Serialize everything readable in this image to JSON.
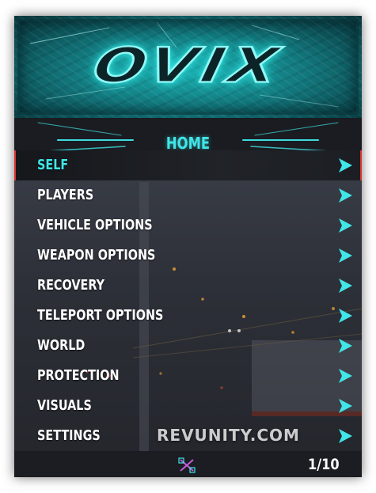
{
  "banner": {
    "logo_text": "OVIX"
  },
  "header": {
    "title": "HOME"
  },
  "menu": {
    "items": [
      {
        "label": "SELF",
        "selected": true
      },
      {
        "label": "PLAYERS"
      },
      {
        "label": "VEHICLE OPTIONS"
      },
      {
        "label": "WEAPON OPTIONS"
      },
      {
        "label": "RECOVERY"
      },
      {
        "label": "TELEPORT OPTIONS"
      },
      {
        "label": "WORLD"
      },
      {
        "label": "PROTECTION"
      },
      {
        "label": "VISUALS"
      },
      {
        "label": "SETTINGS"
      }
    ],
    "arrow_icon": "chevron-right-icon"
  },
  "footer": {
    "page_count": "1/10",
    "logo_icon": "ovix-logo-icon"
  },
  "watermark": {
    "text": "REVUNITY.COM"
  },
  "colors": {
    "accent": "#40e6e8",
    "selection_border": "#d8342f",
    "header_bg": "#1a1c21"
  }
}
